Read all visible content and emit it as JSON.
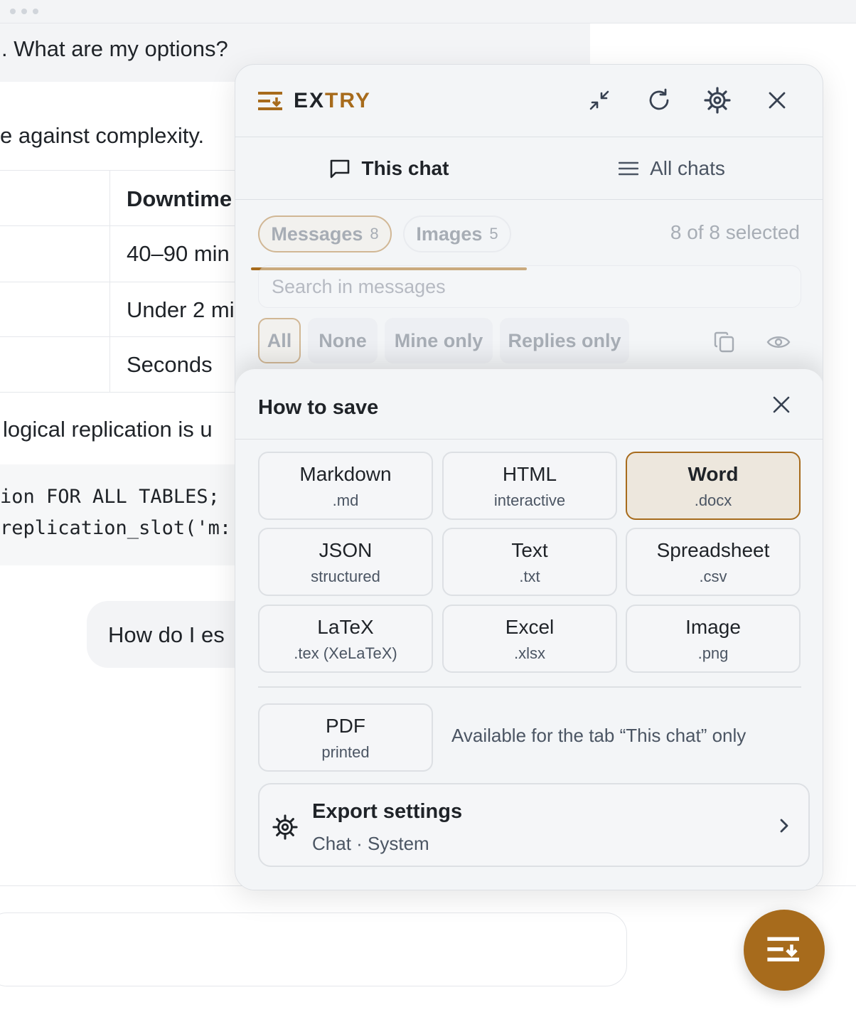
{
  "background": {
    "top_message": ". What are my options?",
    "line_complexity": "e against complexity.",
    "table": {
      "header": "Downtime",
      "rows": [
        "40–90 min",
        "Under 2 mi",
        "Seconds"
      ]
    },
    "line_logical": "logical replication is u",
    "code": [
      "ion FOR ALL TABLES;",
      "replication_slot('m:"
    ],
    "user_bubble": "How do I es"
  },
  "panel": {
    "brand_ex": "EX",
    "brand_try": "TRY",
    "header_icons": [
      "collapse-icon",
      "refresh-icon",
      "gear-icon",
      "close-icon"
    ],
    "tabs": [
      {
        "label": "This chat",
        "icon": "chat-bubble-icon",
        "active": true
      },
      {
        "label": "All chats",
        "icon": "list-icon",
        "active": false
      }
    ],
    "chips": [
      {
        "label": "Messages",
        "count": "8",
        "active": true
      },
      {
        "label": "Images",
        "count": "5",
        "active": false
      }
    ],
    "selected_text": "8 of 8 selected",
    "search_placeholder": "Search in messages",
    "filters": [
      "All",
      "None",
      "Mine only",
      "Replies only"
    ],
    "filter_icons": [
      "copy-icon",
      "eye-icon"
    ]
  },
  "save": {
    "title": "How to save",
    "formats": [
      {
        "name": "Markdown",
        "sub": ".md"
      },
      {
        "name": "HTML",
        "sub": "interactive"
      },
      {
        "name": "Word",
        "sub": ".docx",
        "active": true
      },
      {
        "name": "JSON",
        "sub": "structured"
      },
      {
        "name": "Text",
        "sub": ".txt"
      },
      {
        "name": "Spreadsheet",
        "sub": ".csv"
      },
      {
        "name": "LaTeX",
        "sub": ".tex (XeLaTeX)"
      },
      {
        "name": "Excel",
        "sub": ".xlsx"
      },
      {
        "name": "Image",
        "sub": ".png"
      },
      {
        "name": "PDF",
        "sub": "printed"
      }
    ],
    "pdf_note": "Available for the tab “This chat” only",
    "settings": {
      "title": "Export settings",
      "sub": "Chat · System"
    }
  },
  "colors": {
    "accent": "#a76b1c",
    "active_bg": "#ede7dd"
  }
}
